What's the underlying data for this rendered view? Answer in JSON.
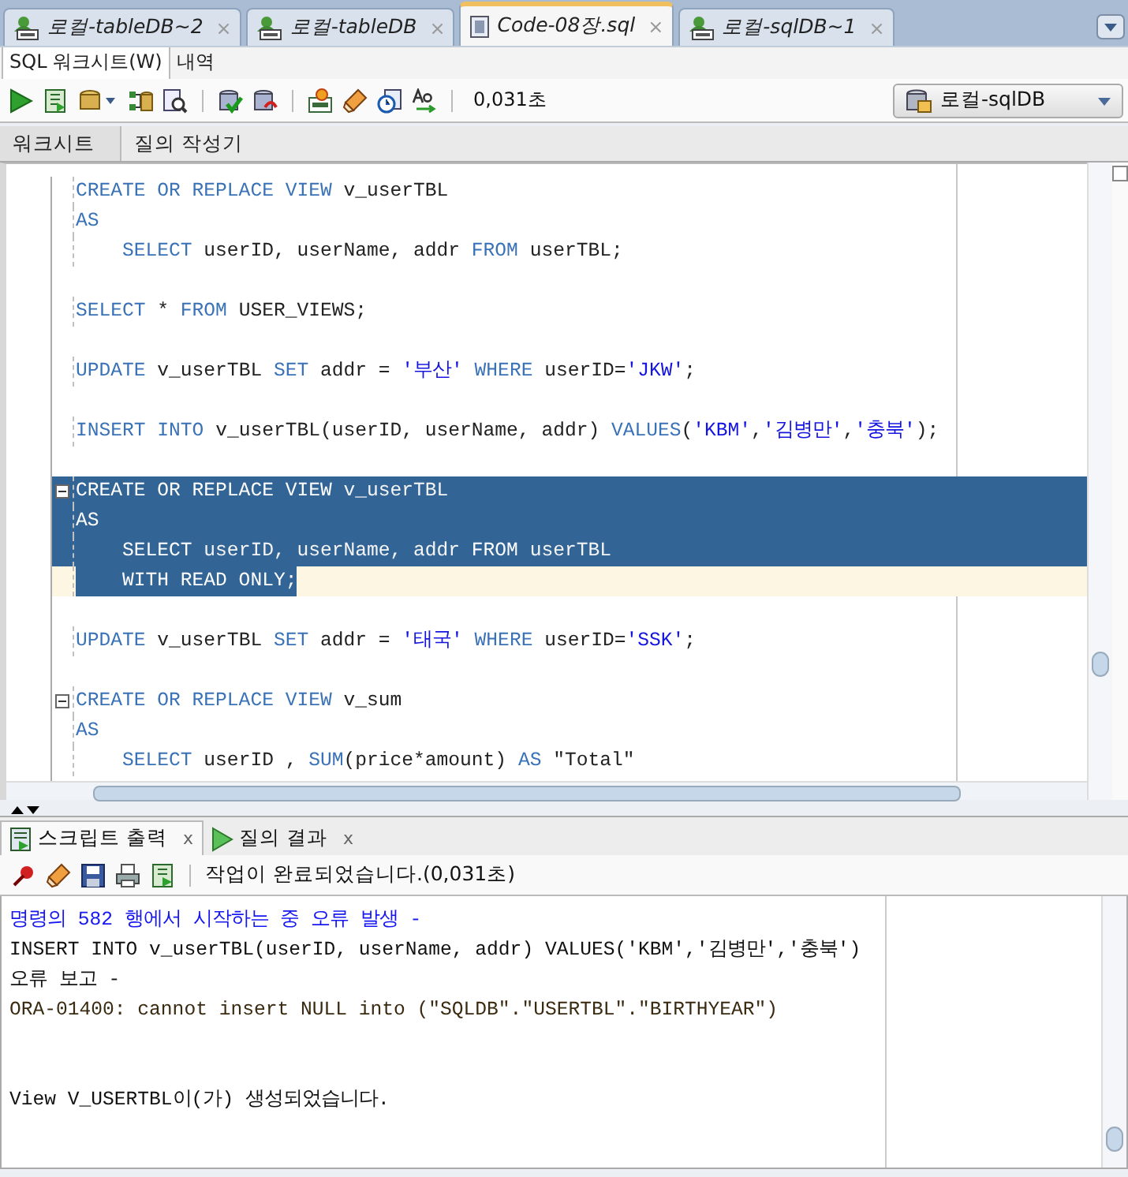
{
  "document_tabs": [
    {
      "label": "로컬-tableDB~2",
      "kind": "connection",
      "selected": false,
      "close": "×"
    },
    {
      "label": "로컬-tableDB",
      "kind": "connection",
      "selected": false,
      "close": "×"
    },
    {
      "label": "Code-08장.sql",
      "kind": "file",
      "selected": true,
      "close": "×"
    },
    {
      "label": "로컬-sqlDB~1",
      "kind": "connection",
      "selected": false,
      "close": "×"
    }
  ],
  "view_tabs": [
    {
      "label": "SQL 워크시트(W)",
      "selected": true
    },
    {
      "label": "내역",
      "selected": false
    }
  ],
  "toolbar": {
    "elapsed": "0,031초",
    "connection": "로컬-sqlDB"
  },
  "side_checkbox": {
    "checked": false
  },
  "worksheet_tabs": [
    {
      "label": "워크시트",
      "selected": true
    },
    {
      "label": "질의 작성기",
      "selected": false
    }
  ],
  "editor_lines": [
    {
      "kind": "code",
      "fold": false,
      "selected": false,
      "current": false,
      "tokens": [
        {
          "t": "CREATE OR REPLACE VIEW",
          "kind": "keyword"
        },
        {
          "t": " v_userTBL",
          "kind": "plain"
        }
      ]
    },
    {
      "kind": "code",
      "fold": false,
      "selected": false,
      "current": false,
      "tokens": [
        {
          "t": "AS",
          "kind": "keyword"
        }
      ]
    },
    {
      "kind": "code",
      "fold": false,
      "selected": false,
      "current": false,
      "tokens": [
        {
          "t": "    SELECT",
          "kind": "keyword"
        },
        {
          "t": " userID, userName, addr ",
          "kind": "plain"
        },
        {
          "t": "FROM",
          "kind": "keyword"
        },
        {
          "t": " userTBL;",
          "kind": "plain"
        }
      ]
    },
    {
      "kind": "blank"
    },
    {
      "kind": "code",
      "fold": false,
      "selected": false,
      "current": false,
      "tokens": [
        {
          "t": "SELECT",
          "kind": "keyword"
        },
        {
          "t": " * ",
          "kind": "plain"
        },
        {
          "t": "FROM",
          "kind": "keyword"
        },
        {
          "t": " USER_VIEWS;",
          "kind": "plain"
        }
      ]
    },
    {
      "kind": "blank"
    },
    {
      "kind": "code",
      "fold": false,
      "selected": false,
      "current": false,
      "tokens": [
        {
          "t": "UPDATE",
          "kind": "keyword"
        },
        {
          "t": " v_userTBL ",
          "kind": "plain"
        },
        {
          "t": "SET",
          "kind": "keyword"
        },
        {
          "t": " addr = ",
          "kind": "plain"
        },
        {
          "t": "'부산'",
          "kind": "string"
        },
        {
          "t": " WHERE",
          "kind": "keyword"
        },
        {
          "t": " userID=",
          "kind": "plain"
        },
        {
          "t": "'JKW'",
          "kind": "string"
        },
        {
          "t": ";",
          "kind": "plain"
        }
      ]
    },
    {
      "kind": "blank"
    },
    {
      "kind": "code",
      "fold": false,
      "selected": false,
      "current": false,
      "tokens": [
        {
          "t": "INSERT INTO",
          "kind": "keyword"
        },
        {
          "t": " v_userTBL(userID, userName, addr) ",
          "kind": "plain"
        },
        {
          "t": "VALUES",
          "kind": "keyword"
        },
        {
          "t": "(",
          "kind": "plain"
        },
        {
          "t": "'KBM'",
          "kind": "string"
        },
        {
          "t": ",",
          "kind": "plain"
        },
        {
          "t": "'김병만'",
          "kind": "string"
        },
        {
          "t": ",",
          "kind": "plain"
        },
        {
          "t": "'충북'",
          "kind": "string"
        },
        {
          "t": ");",
          "kind": "plain"
        }
      ]
    },
    {
      "kind": "blank"
    },
    {
      "kind": "code",
      "fold": true,
      "selected": true,
      "current": false,
      "tokens": [
        {
          "t": "CREATE OR REPLACE VIEW",
          "kind": "keyword"
        },
        {
          "t": " v_userTBL",
          "kind": "plain"
        }
      ]
    },
    {
      "kind": "code",
      "fold": false,
      "selected": true,
      "current": false,
      "tokens": [
        {
          "t": "AS",
          "kind": "keyword"
        }
      ]
    },
    {
      "kind": "code",
      "fold": false,
      "selected": true,
      "current": false,
      "tokens": [
        {
          "t": "    SELECT",
          "kind": "keyword"
        },
        {
          "t": " userID, userName, addr ",
          "kind": "plain"
        },
        {
          "t": "FROM",
          "kind": "keyword"
        },
        {
          "t": " userTBL",
          "kind": "plain"
        }
      ]
    },
    {
      "kind": "code",
      "fold": false,
      "selected": true,
      "current": true,
      "tokens": [
        {
          "t": "    WITH READ ONLY",
          "kind": "keyword"
        },
        {
          "t": ";",
          "kind": "plain"
        }
      ]
    },
    {
      "kind": "blank"
    },
    {
      "kind": "code",
      "fold": false,
      "selected": false,
      "current": false,
      "tokens": [
        {
          "t": "UPDATE",
          "kind": "keyword"
        },
        {
          "t": " v_userTBL ",
          "kind": "plain"
        },
        {
          "t": "SET",
          "kind": "keyword"
        },
        {
          "t": " addr = ",
          "kind": "plain"
        },
        {
          "t": "'태국'",
          "kind": "string"
        },
        {
          "t": " WHERE",
          "kind": "keyword"
        },
        {
          "t": " userID=",
          "kind": "plain"
        },
        {
          "t": "'SSK'",
          "kind": "string"
        },
        {
          "t": ";",
          "kind": "plain"
        }
      ]
    },
    {
      "kind": "blank"
    },
    {
      "kind": "code",
      "fold": true,
      "selected": false,
      "current": false,
      "tokens": [
        {
          "t": "CREATE OR REPLACE VIEW",
          "kind": "keyword"
        },
        {
          "t": " v_sum",
          "kind": "plain"
        }
      ]
    },
    {
      "kind": "code",
      "fold": false,
      "selected": false,
      "current": false,
      "tokens": [
        {
          "t": "AS",
          "kind": "keyword"
        }
      ]
    },
    {
      "kind": "code",
      "fold": false,
      "selected": false,
      "current": false,
      "tokens": [
        {
          "t": "    SELECT",
          "kind": "keyword"
        },
        {
          "t": " userID , ",
          "kind": "plain"
        },
        {
          "t": "SUM",
          "kind": "keyword"
        },
        {
          "t": "(price*amount) ",
          "kind": "plain"
        },
        {
          "t": "AS",
          "kind": "keyword"
        },
        {
          "t": " \"Total\"",
          "kind": "plain"
        }
      ]
    }
  ],
  "output_tabs": [
    {
      "label": "스크립트 출력",
      "kind": "script",
      "selected": true,
      "close": "x"
    },
    {
      "label": "질의 결과",
      "kind": "query",
      "selected": false,
      "close": "x"
    }
  ],
  "output_status": "작업이 완료되었습니다.(0,031초)",
  "output_lines": [
    {
      "kind": "info",
      "text": "명령의 582 행에서 시작하는 중 오류 발생 -"
    },
    {
      "kind": "plain",
      "text": "INSERT INTO v_userTBL(userID, userName, addr) VALUES('KBM','김병만','충북')"
    },
    {
      "kind": "plain",
      "text": "오류 보고 -"
    },
    {
      "kind": "error",
      "text": "ORA-01400: cannot insert NULL into (\"SQLDB\".\"USERTBL\".\"BIRTHYEAR\")"
    },
    {
      "kind": "blank"
    },
    {
      "kind": "blank"
    },
    {
      "kind": "plain",
      "text": "View V_USERTBL이(가) 생성되었습니다."
    }
  ]
}
